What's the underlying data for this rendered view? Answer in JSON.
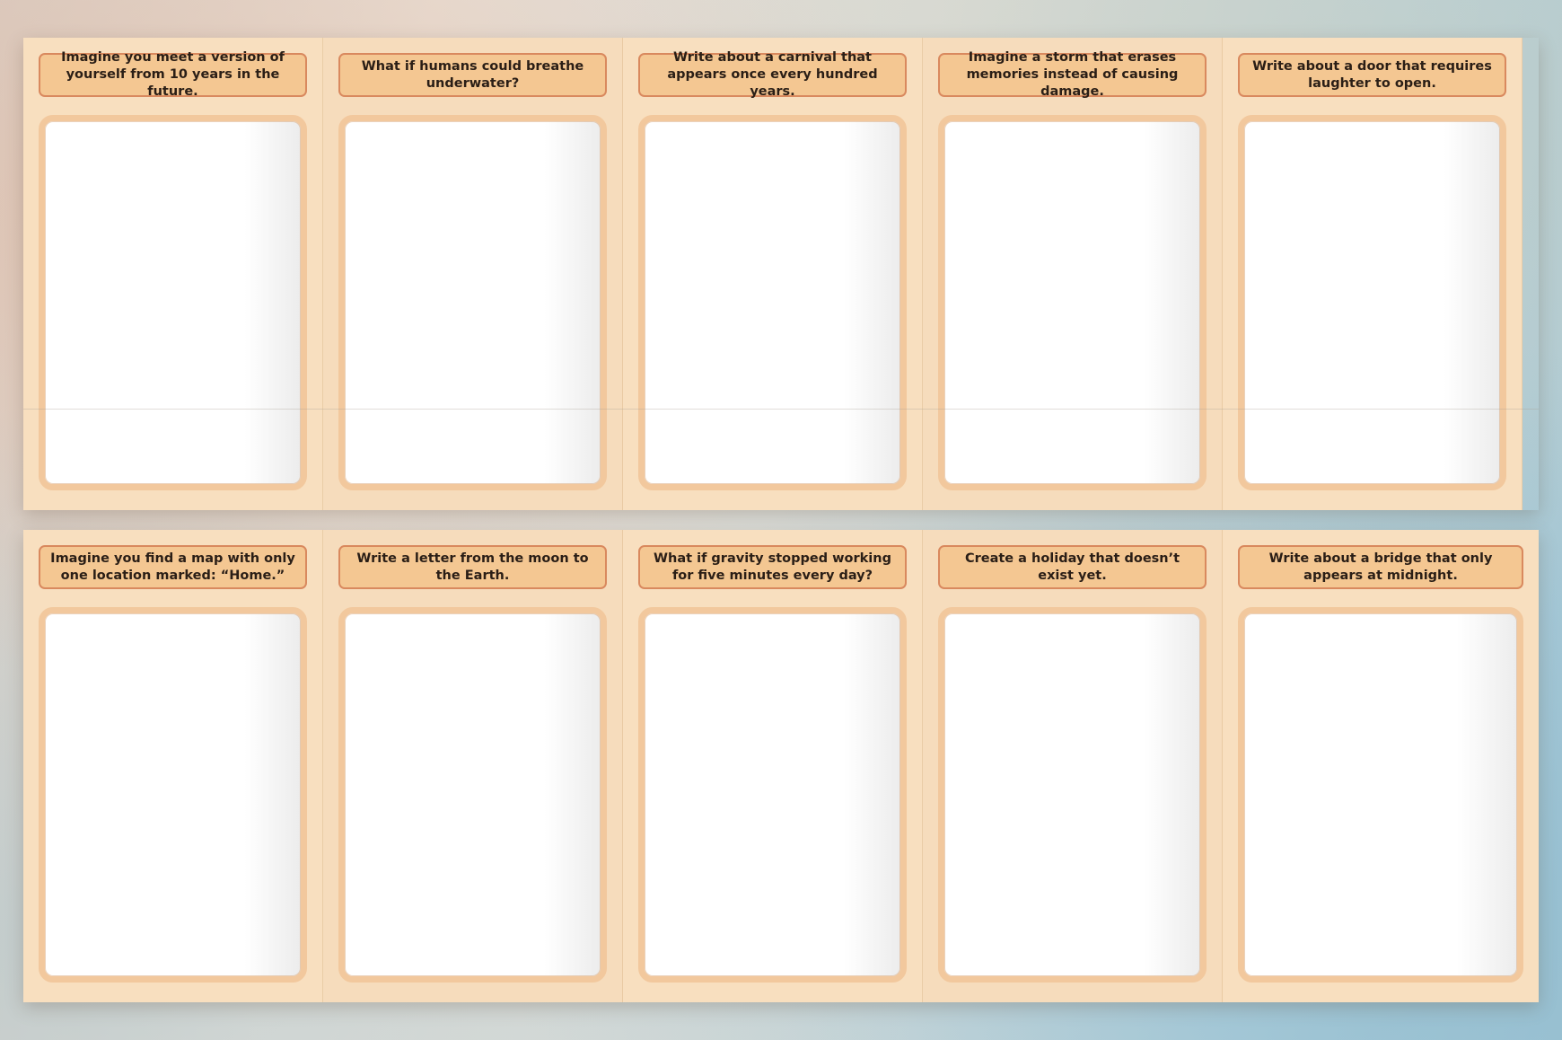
{
  "rows": [
    {
      "cards": [
        {
          "prompt": "Imagine you meet a version of yourself from 10 years in the future."
        },
        {
          "prompt": "What if humans could breathe underwater?"
        },
        {
          "prompt": "Write about a carnival that appears once every hundred years."
        },
        {
          "prompt": "Imagine a storm that erases memories instead of causing damage."
        },
        {
          "prompt": "Write about a door that requires laughter to open."
        }
      ]
    },
    {
      "cards": [
        {
          "prompt": "Imagine you find a map with only one location marked: “Home.”"
        },
        {
          "prompt": "Write a letter from the moon to the Earth."
        },
        {
          "prompt": "What if gravity stopped working for five minutes every day?"
        },
        {
          "prompt": "Create a holiday that doesn’t exist yet."
        },
        {
          "prompt": "Write about a bridge that only appears at midnight."
        }
      ]
    }
  ],
  "colors": {
    "card_background": "#f8dfbf",
    "prompt_fill": "#f4c792",
    "prompt_border": "#d9895e",
    "frame_border": "#f2c89d",
    "text": "#2a1e16"
  }
}
